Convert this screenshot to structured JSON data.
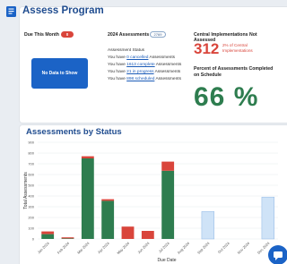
{
  "header": {
    "title": "Assess Program",
    "icon": "document-icon"
  },
  "due_this_month": {
    "title": "Due This Month",
    "count": "0",
    "empty_label": "No Data to Show"
  },
  "assessments_2024": {
    "title": "2024 Assessments",
    "count": "2769",
    "status_label": "Assessment Status",
    "lines": [
      {
        "prefix": "You have ",
        "link": "0 cancelled",
        "suffix": " Assessments"
      },
      {
        "prefix": "You have ",
        "link": "1613 complete",
        "suffix": " Assessments"
      },
      {
        "prefix": "You have ",
        "link": "21 in progress",
        "suffix": " Assessments"
      },
      {
        "prefix": "You have ",
        "link": "898 scheduled",
        "suffix": " Assessments"
      }
    ]
  },
  "central": {
    "title": "Central Implementations Not Assessed",
    "value": "312",
    "note": "2% of Central Implementations",
    "sub_title": "Percent of Assessments Completed on Schedule",
    "percent": "66 %"
  },
  "chart_section": {
    "title": "Assessments by Status"
  },
  "chart_data": {
    "type": "bar",
    "stacked": true,
    "ylabel": "Total Assessments",
    "xlabel": "Due Date",
    "ylim": [
      0,
      900
    ],
    "yticks": [
      0,
      100,
      200,
      300,
      400,
      500,
      600,
      700,
      800,
      900
    ],
    "categories": [
      "Jan 2024",
      "Feb 2024",
      "Mar 2024",
      "Apr 2024",
      "May 2024",
      "Jun 2024",
      "Jul 2024",
      "Aug 2024",
      "Sep 2024",
      "Oct 2024",
      "Nov 2024",
      "Dec 2024"
    ],
    "series": [
      {
        "color": "#2e7d4f",
        "values": [
          45,
          5,
          750,
          355,
          0,
          0,
          635,
          0,
          0,
          0,
          0,
          0
        ]
      },
      {
        "color": "#d9453b",
        "values": [
          25,
          10,
          20,
          15,
          115,
          75,
          85,
          0,
          0,
          0,
          0,
          0
        ]
      },
      {
        "color": "#cfe3f7",
        "values": [
          0,
          0,
          0,
          0,
          0,
          0,
          0,
          0,
          255,
          0,
          0,
          390
        ]
      }
    ]
  },
  "colors": {
    "brand": "#1f4c8f",
    "accent": "#1b63c6",
    "red": "#d9453b",
    "green": "#2e7d4f"
  }
}
